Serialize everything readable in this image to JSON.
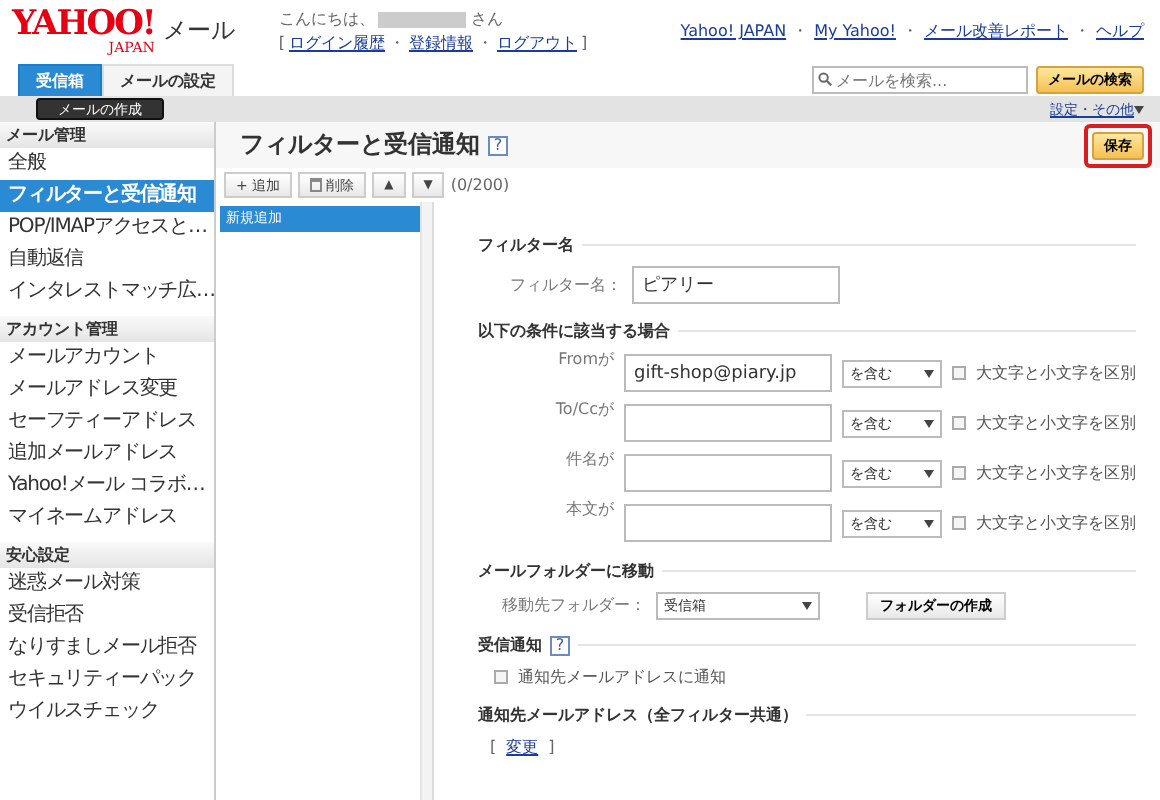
{
  "header": {
    "logo_main": "YAHOO!",
    "logo_sub": "JAPAN",
    "service": "メール",
    "greeting_prefix": "こんにちは、",
    "greeting_suffix": "さん",
    "separator": "・",
    "account_links": [
      "ログイン履歴",
      "登録情報",
      "ログアウト"
    ],
    "top_links": [
      "Yahoo! JAPAN",
      "My Yahoo!",
      "メール改善レポート",
      "ヘルプ"
    ]
  },
  "tabs": [
    {
      "label": "受信箱",
      "selected": true
    },
    {
      "label": "メールの設定",
      "selected": false
    }
  ],
  "search": {
    "placeholder": "メールを検索...",
    "button": "メールの検索"
  },
  "compose_button": "メールの作成",
  "settings_menu": "設定・その他",
  "sidebar": [
    {
      "title": "メール管理",
      "items": [
        {
          "label": "全般",
          "selected": false
        },
        {
          "label": "フィルターと受信通知",
          "selected": true
        },
        {
          "label": "POP/IMAPアクセスと…",
          "selected": false
        },
        {
          "label": "自動返信",
          "selected": false
        },
        {
          "label": "インタレストマッチ広…",
          "selected": false
        }
      ]
    },
    {
      "title": "アカウント管理",
      "items": [
        {
          "label": "メールアカウント",
          "selected": false
        },
        {
          "label": "メールアドレス変更",
          "selected": false
        },
        {
          "label": "セーフティーアドレス",
          "selected": false
        },
        {
          "label": "追加メールアドレス",
          "selected": false
        },
        {
          "label": "Yahoo!メール コラボ…",
          "selected": false
        },
        {
          "label": "マイネームアドレス",
          "selected": false
        }
      ]
    },
    {
      "title": "安心設定",
      "items": [
        {
          "label": "迷惑メール対策",
          "selected": false
        },
        {
          "label": "受信拒否",
          "selected": false
        },
        {
          "label": "なりすましメール拒否",
          "selected": false
        },
        {
          "label": "セキュリティーパック",
          "selected": false
        },
        {
          "label": "ウイルスチェック",
          "selected": false
        }
      ]
    }
  ],
  "page": {
    "title": "フィルターと受信通知",
    "help": "?",
    "save_button": "保存"
  },
  "toolbar": {
    "add": "+ 追加",
    "delete": "削除",
    "up": "▲",
    "down": "▼",
    "count": "(0/200)"
  },
  "filter_list": [
    {
      "label": "新規追加",
      "selected": true
    }
  ],
  "form": {
    "name_section": "フィルター名",
    "name_label": "フィルター名：",
    "name_value": "ピアリー",
    "conditions_section": "以下の条件に該当する場合",
    "conditions": [
      {
        "label": "Fromが",
        "value": "gift-shop@piary.jp",
        "match": "を含む",
        "case_label": "大文字と小文字を区別",
        "case_sensitive": false
      },
      {
        "label": "To/Ccが",
        "match": "を含む",
        "case_label": "大文字と小文字を区別",
        "case_sensitive": false
      },
      {
        "label": "件名が",
        "match": "を含む",
        "case_label": "大文字と小文字を区別",
        "case_sensitive": false
      },
      {
        "label": "本文が",
        "match": "を含む",
        "case_label": "大文字と小文字を区別",
        "case_sensitive": false
      }
    ],
    "move_section": "メールフォルダーに移動",
    "folder_label": "移動先フォルダー：",
    "folder_value": "受信箱",
    "create_folder_button": "フォルダーの作成",
    "notify_section": "受信通知",
    "notify_help": "?",
    "notify_label": "通知先メールアドレスに通知",
    "notify_checked": false,
    "address_section": "通知先メールアドレス（全フィルター共通）",
    "change_link": "変更",
    "bracket_open": "[",
    "bracket_close": "]"
  }
}
